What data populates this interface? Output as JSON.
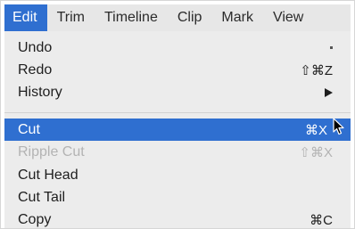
{
  "menubar": {
    "items": [
      "Edit",
      "Trim",
      "Timeline",
      "Clip",
      "Mark",
      "View"
    ]
  },
  "edit_menu": {
    "items": [
      {
        "label": "Undo",
        "shortcut": "`",
        "disabled": false
      },
      {
        "label": "Redo",
        "shortcut": "⇧⌘Z",
        "disabled": false
      },
      {
        "label": "History",
        "shortcut": "",
        "submenu": true,
        "disabled": false
      },
      {
        "label": "Cut",
        "shortcut": "⌘X",
        "disabled": false,
        "highlighted": true
      },
      {
        "label": "Ripple Cut",
        "shortcut": "⇧⌘X",
        "disabled": true
      },
      {
        "label": "Cut Head",
        "shortcut": "",
        "disabled": false
      },
      {
        "label": "Cut Tail",
        "shortcut": "",
        "disabled": false
      },
      {
        "label": "Copy",
        "shortcut": "⌘C",
        "disabled": false
      }
    ]
  },
  "colors": {
    "highlight": "#2f6fd0",
    "menu_background": "#ececec",
    "disabled_text": "#b3b3b3"
  }
}
